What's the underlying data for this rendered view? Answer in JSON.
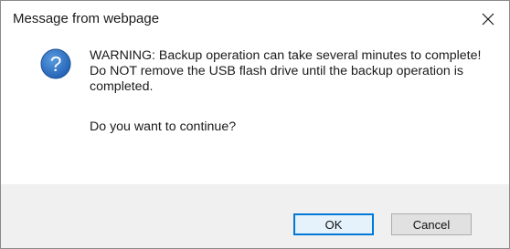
{
  "dialog": {
    "title": "Message from webpage",
    "close_icon": "close-icon",
    "icon": "question-icon",
    "message": "WARNING: Backup operation can take several minutes to complete! Do NOT remove the USB flash drive until the backup operation is completed.",
    "question": "Do you want to continue?",
    "buttons": {
      "ok": "OK",
      "cancel": "Cancel"
    },
    "colors": {
      "icon_blue": "#2f78cc",
      "default_button_border": "#0078d7",
      "footer_bg": "#f0f0f0"
    }
  }
}
